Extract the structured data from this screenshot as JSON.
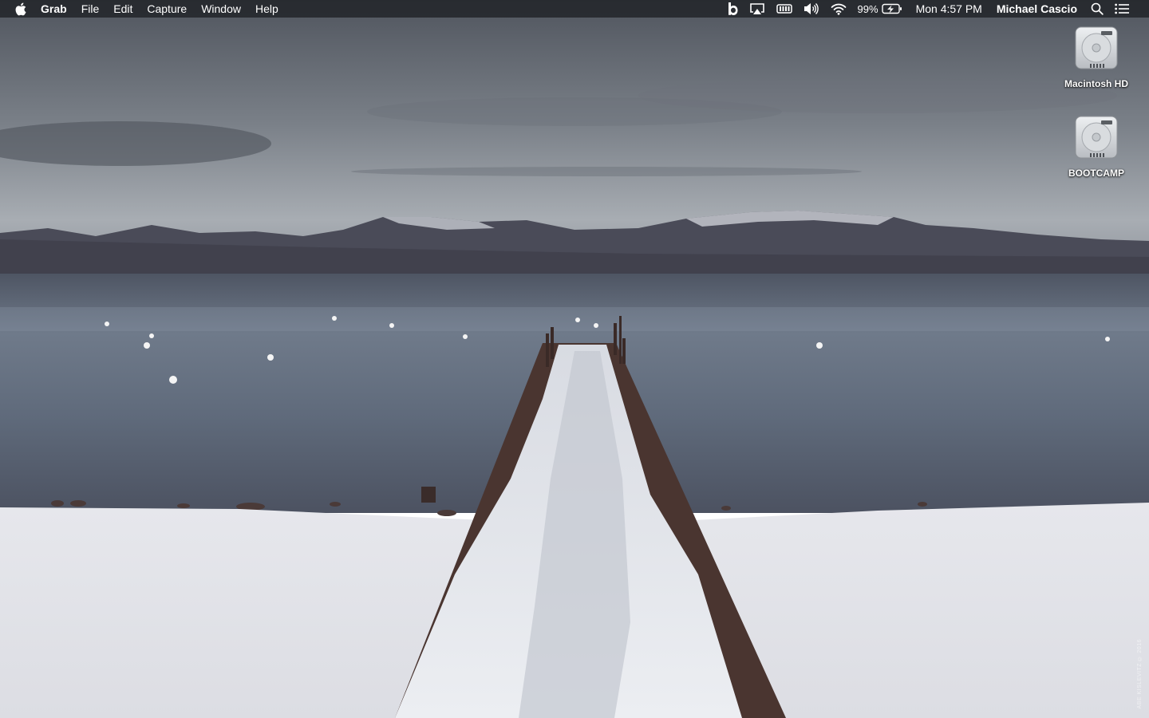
{
  "menubar": {
    "app_name": "Grab",
    "menus": [
      "File",
      "Edit",
      "Capture",
      "Window",
      "Help"
    ],
    "battery_percent": "99%",
    "clock": "Mon 4:57 PM",
    "user_name": "Michael Cascio",
    "status_icons": [
      "bold-b-icon",
      "airplay-icon",
      "battery-menu-icon",
      "volume-icon",
      "wifi-icon",
      "battery-charging-icon",
      "spotlight-icon",
      "notification-center-icon"
    ]
  },
  "desktop": {
    "icons": [
      {
        "label": "Macintosh HD",
        "icon": "hard-drive-icon"
      },
      {
        "label": "BOOTCAMP",
        "icon": "hard-drive-icon"
      }
    ]
  },
  "wallpaper": {
    "description_colors": {
      "sky": "#5f656e",
      "mountains": "#4a4c58",
      "water": "#6c7888",
      "snow": "#e9eaee",
      "dock_wood": "#4a3530"
    },
    "watermark": "ABE KISLEVITZ © 2016"
  }
}
